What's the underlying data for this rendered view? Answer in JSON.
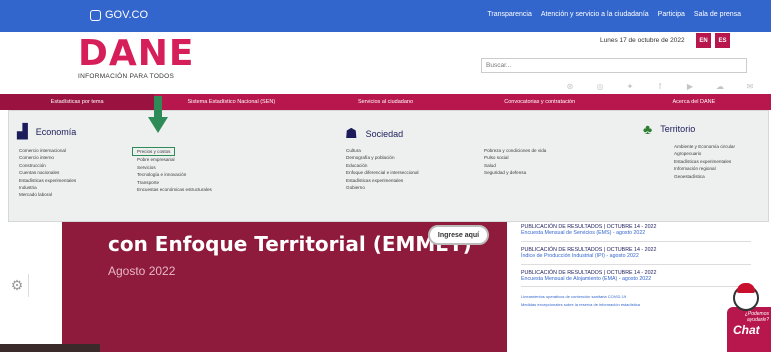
{
  "govbar": {
    "logo_text": "GOV.CO",
    "links": [
      "Transparencia",
      "Atención y servicio a la ciudadanía",
      "Participa",
      "Sala de prensa"
    ]
  },
  "header": {
    "logo_word": "DANE",
    "logo_sub": "INFORMACIÓN PARA TODOS",
    "date": "Lunes 17 de octubre de 2022",
    "lang_en": "EN",
    "lang_es": "ES",
    "search_placeholder": "Buscar..."
  },
  "socials": [
    "rss-icon",
    "instagram-icon",
    "twitter-icon",
    "facebook-icon",
    "youtube-icon",
    "soundcloud-icon",
    "mail-icon"
  ],
  "nav": [
    "Estadísticas por tema",
    "Sistema Estadístico Nacional (SEN)",
    "Servicios al ciudadano",
    "Convocatorias y contratación",
    "Acerca del DANE"
  ],
  "mega": {
    "economia": {
      "title": "Economía",
      "col1": [
        "Comercio internacional",
        "Comercio interno",
        "Construcción",
        "Cuentas nacionales",
        "Estadísticas experimentales",
        "Industria",
        "Mercado laboral"
      ],
      "col2": [
        "Precios y costos",
        "Pobre empresarial",
        "Servicios",
        "Tecnología e innovación",
        "Transporte",
        "Encuestas económicas estructurales"
      ]
    },
    "sociedad": {
      "title": "Sociedad",
      "col1": [
        "Cultura",
        "Demografía y población",
        "Educación",
        "Enfoque diferencial e interseccional",
        "Estadísticas experimentales",
        "Gobierno"
      ],
      "col2": [
        "Pobreza y condiciones de vida",
        "Pulso social",
        "Salud",
        "Seguridad y defensa"
      ]
    },
    "territorio": {
      "title": "Territorio",
      "col1": [
        "Ambiente y Economía circular",
        "Agropecuario",
        "Estadísticas experimentales",
        "Información regional",
        "Geoestadística"
      ]
    }
  },
  "hero": {
    "title": "con Enfoque Territorial (EMMET)",
    "subtitle": "Agosto 2022",
    "cta": "Ingrese aquí"
  },
  "news": [
    {
      "head": "PUBLICACIÓN DE RESULTADOS | OCTUBRE 14 - 2022",
      "sub": "Encuesta Mensual de Servicios (EMS) - agosto 2022"
    },
    {
      "head": "PUBLICACIÓN DE RESULTADOS | OCTUBRE 14 - 2022",
      "sub": "Índice de Producción Industrial (IPI) - agosto 2022"
    },
    {
      "head": "PUBLICACIÓN DE RESULTADOS | OCTUBRE 14 - 2022",
      "sub": "Encuesta Mensual de Alojamiento (EMA) - agosto 2022"
    }
  ],
  "news_links": [
    "Lineamientos operativos de contención sanitaria COVID-19",
    "Medidas excepcionales sobre la reserva de información estadística"
  ],
  "chat": {
    "question": "¿Podemos ayudarle?",
    "label": "Chat"
  }
}
